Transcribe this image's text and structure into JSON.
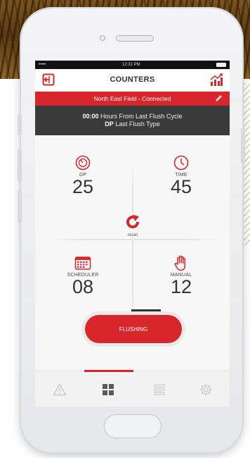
{
  "status_bar": {
    "carrier": "••••• ",
    "time": "12:31 PM"
  },
  "app_bar": {
    "title": "COUNTERS",
    "logout_icon": "logout-icon",
    "chart_icon": "chart-icon"
  },
  "connection": {
    "text": "North East Field - Connected",
    "edit_icon": "pencil-icon"
  },
  "info": {
    "time_value": "00:00",
    "time_text": "Hours From Last Flush Cycle",
    "type_value": "DP",
    "type_text": "Last Flush Type"
  },
  "counters": {
    "dp": {
      "label": "DP",
      "value": "25",
      "icon": "gauge-icon"
    },
    "time": {
      "label": "TIME",
      "value": "45",
      "icon": "clock-icon"
    },
    "scheduler": {
      "label": "SCHEDULER",
      "value": "08",
      "icon": "calendar-icon"
    },
    "manual": {
      "label": "MANUAL",
      "value": "12",
      "icon": "hand-icon"
    }
  },
  "reset": {
    "label": "reset",
    "icon": "refresh-icon"
  },
  "flush_button": {
    "label": "FLUSHING"
  },
  "nav": [
    "warning-icon",
    "grid-icon",
    "list-icon",
    "gear-icon"
  ],
  "colors": {
    "accent": "#d9262c",
    "dark_bar": "#3a3a3a"
  }
}
